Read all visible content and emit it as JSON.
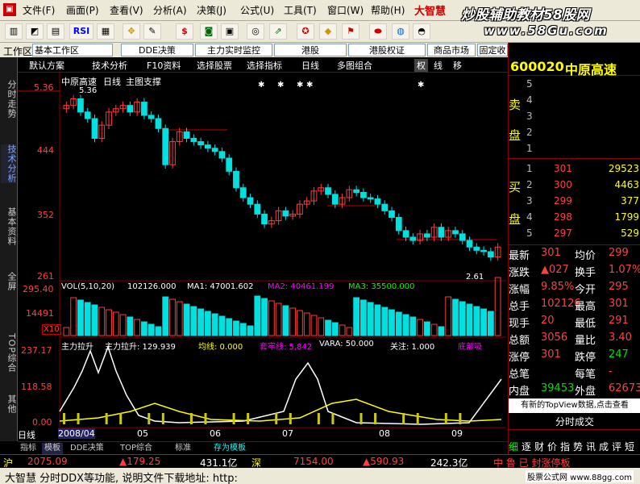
{
  "menu": {
    "items": [
      "文件(F)",
      "画面(P)",
      "查看(V)",
      "分析(A)",
      "决策(J)",
      "公式(U)",
      "工具(T)",
      "窗口(W)",
      "帮助(H)"
    ],
    "brand": "大智慧",
    "watermark_title": "炒股辅助教材58股网",
    "watermark_url": "www.58Gu.com"
  },
  "toolbar": {
    "rsi_label": "RSI"
  },
  "workspace": {
    "label": "工作区",
    "current": "基本工作区",
    "tabs": [
      "DDE决策",
      "主力实时监控",
      "港股",
      "港股权证",
      "商品市场",
      "固定收益平台"
    ]
  },
  "sidebar": {
    "items": [
      "分时走势",
      "技术分析",
      "基本资料",
      "全屏",
      "TOP综合",
      "其他"
    ]
  },
  "chartbar": {
    "items": [
      "默认方案",
      "技术分析",
      "F10资料",
      "选择股票",
      "选择指标",
      "日线",
      "多图组合",
      "权",
      "线",
      "移"
    ]
  },
  "chart": {
    "stock_label": "中原高速",
    "period": "日线",
    "support_label": "主图支撑",
    "price_axis": [
      "5.36",
      "444",
      "352",
      "261"
    ],
    "high_marker": "5.36",
    "low_marker": "2.61",
    "vol_header": {
      "name": "VOL(5,10,20)",
      "value": "102126.000",
      "ma1": "MA1: 47001.602",
      "ma2": "MA2: 40461.199",
      "ma3": "MA3: 35500.000"
    },
    "vol_axis": [
      "295.40",
      "14491"
    ],
    "vol_unit": "X10",
    "ind_header": {
      "name": "主力拉升",
      "v1": "主力拉升: 129.939",
      "v2": "均线: 0.000",
      "v3": "套牢线: 5.842",
      "v4": "VARA: 50.000",
      "v5": "关注: 1.000",
      "v6": "底部吸"
    },
    "ind_axis": [
      "237.17",
      "118.58",
      "0.00"
    ],
    "time_axis": [
      "日线",
      "2008/04",
      "05",
      "06",
      "07",
      "08",
      "09"
    ]
  },
  "chart_data": {
    "type": "candlestick",
    "title": "中原高速 日线",
    "ylim": [
      2.5,
      5.5
    ],
    "close": [
      5.1,
      5.2,
      5.0,
      4.9,
      4.6,
      4.8,
      5.0,
      5.05,
      5.1,
      5.0,
      5.15,
      4.95,
      4.9,
      4.75,
      4.2,
      4.55,
      4.7,
      4.6,
      4.55,
      4.5,
      4.45,
      4.4,
      4.3,
      4.1,
      3.85,
      3.7,
      3.6,
      3.45,
      3.3,
      3.35,
      3.5,
      3.42,
      3.45,
      3.6,
      3.65,
      3.8,
      3.85,
      3.75,
      3.6,
      3.7,
      3.82,
      3.78,
      3.7,
      3.68,
      3.6,
      3.5,
      3.4,
      3.2,
      3.1,
      3.05,
      3.15,
      3.1,
      3.25,
      3.1,
      3.2,
      3.15,
      3.05,
      2.95,
      2.9,
      2.88,
      2.8,
      2.95
    ]
  },
  "rpanel": {
    "code": "600020",
    "name": "中原高速",
    "sell_label_top": "卖",
    "sell_label_bottom": "盘",
    "buy_label_top": "买",
    "buy_label_bottom": "盘",
    "sell": [
      {
        "lvl": "5",
        "price": "",
        "vol": ""
      },
      {
        "lvl": "4",
        "price": "",
        "vol": ""
      },
      {
        "lvl": "3",
        "price": "",
        "vol": ""
      },
      {
        "lvl": "2",
        "price": "",
        "vol": ""
      },
      {
        "lvl": "1",
        "price": "",
        "vol": ""
      }
    ],
    "buy": [
      {
        "lvl": "1",
        "price": "301",
        "vol": "29523"
      },
      {
        "lvl": "2",
        "price": "300",
        "vol": "4463"
      },
      {
        "lvl": "3",
        "price": "299",
        "vol": "377"
      },
      {
        "lvl": "4",
        "price": "298",
        "vol": "1799"
      },
      {
        "lvl": "5",
        "price": "297",
        "vol": "529"
      }
    ],
    "stats": [
      {
        "k1": "最新",
        "v1": "301",
        "k2": "均价",
        "v2": "299"
      },
      {
        "k1": "涨跌",
        "v1": "▲027",
        "k2": "换手",
        "v2": "1.07%"
      },
      {
        "k1": "涨幅",
        "v1": "9.85%",
        "k2": "今开",
        "v2": "295"
      },
      {
        "k1": "总手",
        "v1": "102126",
        "k2": "最高",
        "v2": "301"
      },
      {
        "k1": "现手",
        "v1": "20",
        "k2": "最低",
        "v2": "291"
      },
      {
        "k1": "总额",
        "v1": "3056",
        "k2": "量比",
        "v2": "3.40"
      },
      {
        "k1": "涨停",
        "v1": "301",
        "k2": "跌停",
        "v2": "247"
      },
      {
        "k1": "总笔",
        "v1": "",
        "k2": "每笔",
        "v2": "-"
      },
      {
        "k1": "内盘",
        "v1": "39453",
        "k2": "外盘",
        "v2": "62673"
      }
    ],
    "topview_notice": "有新的TopView数据,点击查看",
    "fenshi_label": "分时成交",
    "bottom_tabs": [
      "细",
      "逐",
      "财",
      "价",
      "指",
      "势",
      "讯",
      "成",
      "评",
      "短"
    ]
  },
  "bottomtabs": [
    "指标",
    "模板",
    "DDE决策",
    "TOP综合",
    "标准",
    "存为模板"
  ],
  "statusbar": {
    "market": "沪",
    "index": "2075.09",
    "change": "▲179.25",
    "amount": "431.1亿",
    "sz_label": "深",
    "sz_index": "7154.00",
    "sz_change": "▲590.93",
    "sz_amount": "242.3亿",
    "news": "中 鲁 已 封涨停板"
  },
  "ticker": {
    "text": "大智慧 分时DDX等功能, 说明文件下载地址: http:",
    "site": "股票公式网 www.88gg.com"
  }
}
